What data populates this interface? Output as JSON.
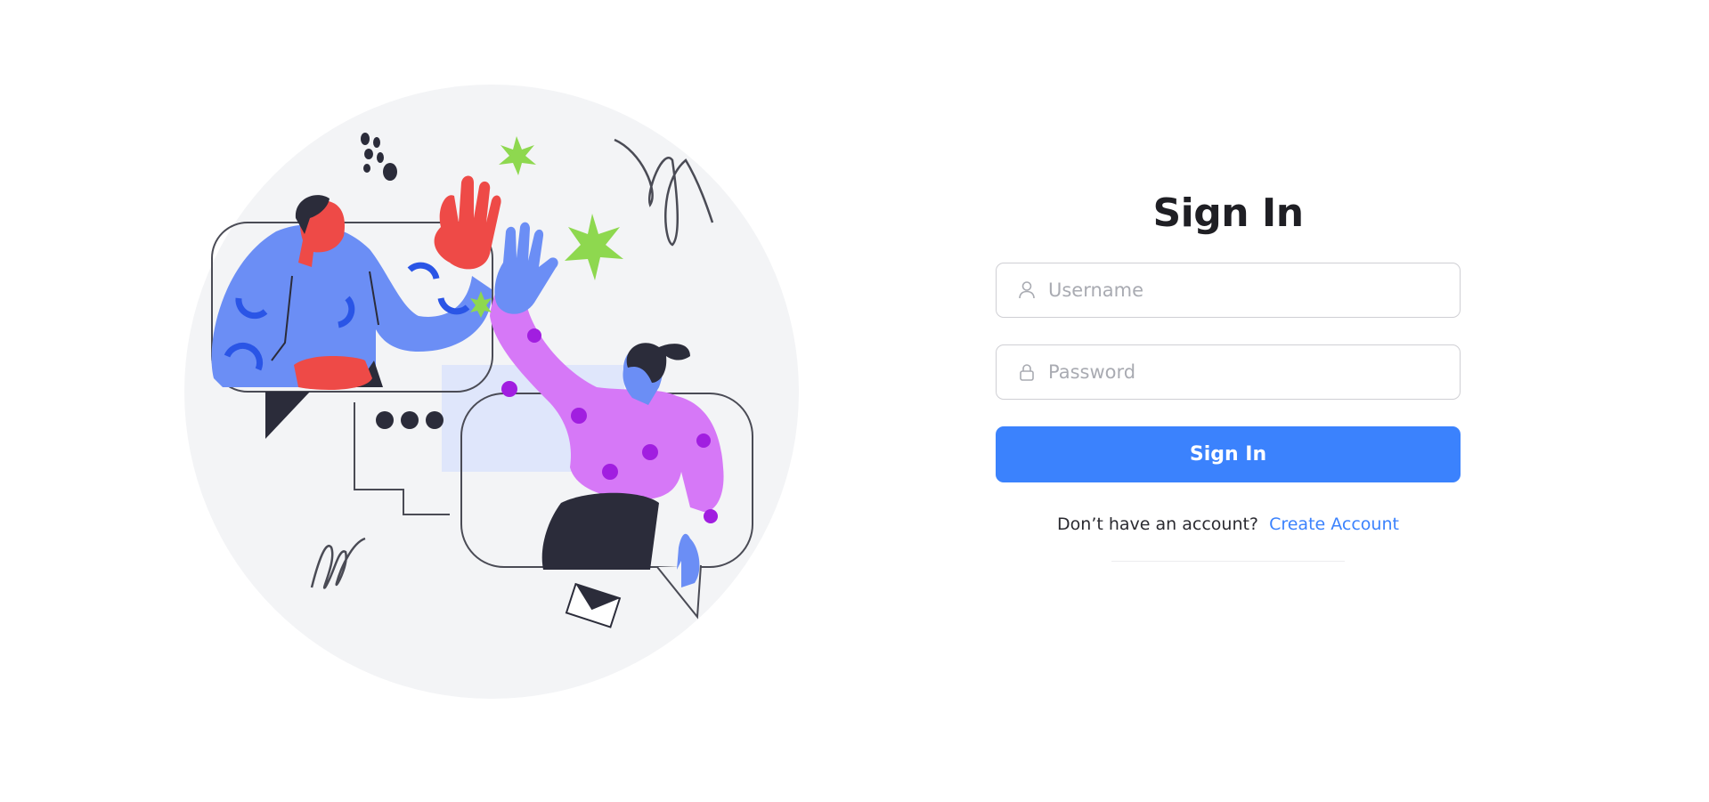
{
  "form": {
    "title": "Sign In",
    "username": {
      "placeholder": "Username",
      "value": ""
    },
    "password": {
      "placeholder": "Password",
      "value": ""
    },
    "submit_label": "Sign In",
    "signup_prompt": "Don’t have an account?",
    "signup_link": "Create Account"
  },
  "icons": {
    "username": "user-icon",
    "password": "lock-icon"
  },
  "colors": {
    "accent": "#3b82fd",
    "title": "#1f1f24",
    "border": "#cfcfd4",
    "placeholder": "#a9abb2",
    "illustration_bg": "#f3f4f6",
    "man_shirt": "#6b8ef5",
    "man_skin": "#ee4a47",
    "woman_shirt": "#d678f7",
    "woman_dots": "#a11ee0",
    "sparkle": "#8ed84f"
  }
}
